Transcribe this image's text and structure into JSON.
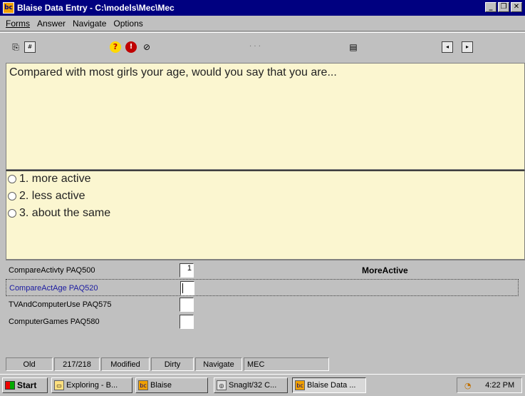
{
  "window": {
    "icon_text": "bc",
    "title": "Blaise Data Entry - C:\\models\\Mec\\Mec",
    "controls": {
      "minimize": "_",
      "restore": "❐",
      "close": "✕"
    }
  },
  "menu": [
    {
      "label": "Forms"
    },
    {
      "label": "Answer"
    },
    {
      "label": "Navigate"
    },
    {
      "label": "Options"
    }
  ],
  "toolbar": {
    "icons": [
      "copy-icon",
      "form-icon",
      "help-icon",
      "stop-icon",
      "paperclip-icon",
      "ellipsis",
      "document-search-icon",
      "prev-form-icon",
      "next-form-icon"
    ],
    "ellipsis": "· · ·"
  },
  "question": {
    "text": "Compared with most girls your age, would you say that you are..."
  },
  "answers": [
    {
      "label": "1. more active"
    },
    {
      "label": "2. less active"
    },
    {
      "label": "3. about the same"
    }
  ],
  "fields": [
    {
      "label": "CompareActivty PAQ500",
      "value": "1",
      "answer_text": "MoreActive"
    },
    {
      "label": "CompareActAge PAQ520",
      "value": "",
      "answer_text": ""
    },
    {
      "label": "TVAndComputerUse PAQ575",
      "value": "",
      "answer_text": ""
    },
    {
      "label": "ComputerGames PAQ580",
      "value": "",
      "answer_text": ""
    }
  ],
  "status": {
    "mode": "Old",
    "counter": "217/218",
    "modified": "Modified",
    "dirty": "Dirty",
    "navigate": "Navigate",
    "instrument": "MEC"
  },
  "taskbar": {
    "start": "Start",
    "tasks": [
      {
        "label": "Exploring - B..."
      },
      {
        "label": "Blaise"
      },
      {
        "label": "SnagIt/32 C..."
      },
      {
        "label": "Blaise Data ..."
      }
    ],
    "clock": "4:22 PM"
  },
  "colors": {
    "titlebar": "#000080",
    "pane_bg": "#fbf6d0",
    "window_bg": "#c0c0c0",
    "active_label": "#1a1aa0"
  }
}
